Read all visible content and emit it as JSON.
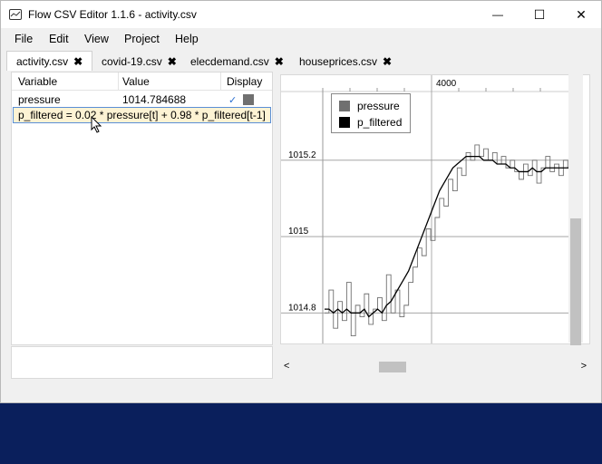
{
  "window": {
    "title": "Flow CSV Editor 1.1.6 - activity.csv",
    "minimize_glyph": "—",
    "maximize_glyph": "☐",
    "close_glyph": "✕"
  },
  "menu": {
    "file": "File",
    "edit": "Edit",
    "view": "View",
    "project": "Project",
    "help": "Help"
  },
  "tabs": [
    {
      "label": "activity.csv",
      "close": "✖"
    },
    {
      "label": "covid-19.csv",
      "close": "✖"
    },
    {
      "label": "elecdemand.csv",
      "close": "✖"
    },
    {
      "label": "houseprices.csv",
      "close": "✖"
    }
  ],
  "grid": {
    "headers": {
      "variable": "Variable",
      "value": "Value",
      "display": "Display"
    },
    "rows": [
      {
        "variable": "pressure",
        "value": "1014.784688",
        "checked": "✓",
        "color": "#707070"
      }
    ],
    "edit_value": "p_filtered = 0.02 * pressure[t] + 0.98 * p_filtered[t-1]"
  },
  "chart_data": {
    "type": "line",
    "top_tick": "4000",
    "yticks": [
      "1015.2",
      "1015",
      "1014.8"
    ],
    "ylim": [
      1014.72,
      1015.38
    ],
    "grid": true,
    "legend_position": "top-left",
    "series": [
      {
        "name": "pressure",
        "color": "#707070",
        "style": "step",
        "values": [
          1014.8,
          1014.86,
          1014.76,
          1014.83,
          1014.78,
          1014.88,
          1014.74,
          1014.82,
          1014.79,
          1014.85,
          1014.77,
          1014.81,
          1014.84,
          1014.78,
          1014.9,
          1014.8,
          1014.86,
          1014.79,
          1014.82,
          1014.88,
          1014.92,
          1014.97,
          1014.95,
          1015.02,
          1014.99,
          1015.05,
          1015.1,
          1015.08,
          1015.15,
          1015.12,
          1015.18,
          1015.16,
          1015.22,
          1015.2,
          1015.24,
          1015.21,
          1015.23,
          1015.2,
          1015.22,
          1015.19,
          1015.21,
          1015.18,
          1015.2,
          1015.17,
          1015.15,
          1015.19,
          1015.16,
          1015.2,
          1015.14,
          1015.18,
          1015.21,
          1015.17,
          1015.19,
          1015.16,
          1015.2,
          1015.18,
          1015.19,
          1015.18
        ]
      },
      {
        "name": "p_filtered",
        "color": "#000000",
        "style": "line",
        "values": [
          1014.81,
          1014.81,
          1014.8,
          1014.81,
          1014.8,
          1014.81,
          1014.8,
          1014.8,
          1014.8,
          1014.81,
          1014.79,
          1014.8,
          1014.81,
          1014.8,
          1014.82,
          1014.83,
          1014.85,
          1014.87,
          1014.89,
          1014.91,
          1014.94,
          1014.97,
          1015.0,
          1015.03,
          1015.06,
          1015.09,
          1015.12,
          1015.14,
          1015.16,
          1015.18,
          1015.19,
          1015.2,
          1015.21,
          1015.21,
          1015.21,
          1015.21,
          1015.2,
          1015.2,
          1015.2,
          1015.19,
          1015.19,
          1015.19,
          1015.18,
          1015.18,
          1015.17,
          1015.17,
          1015.17,
          1015.18,
          1015.17,
          1015.17,
          1015.18,
          1015.18,
          1015.18,
          1015.18,
          1015.18,
          1015.18,
          1015.18,
          1015.18
        ]
      }
    ]
  }
}
